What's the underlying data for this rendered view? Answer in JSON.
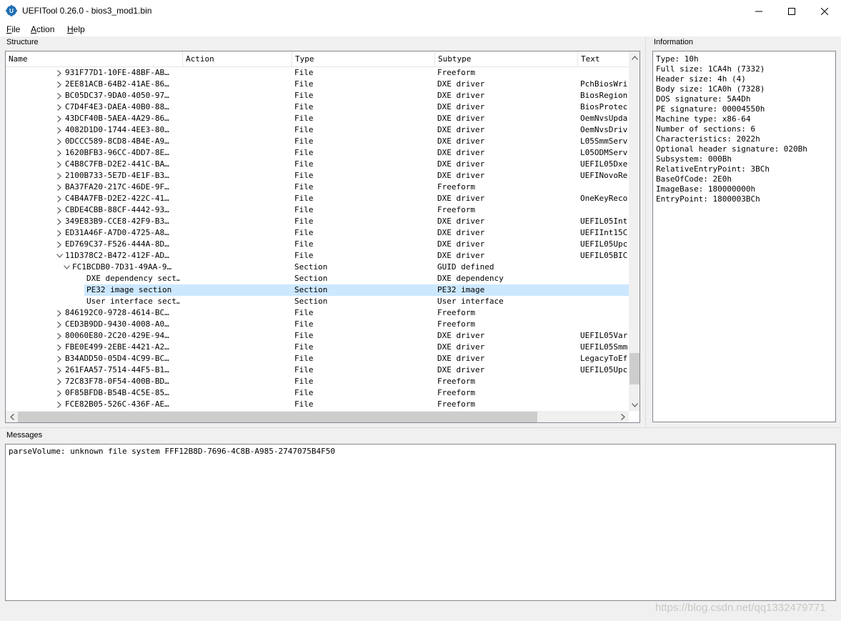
{
  "window": {
    "title": "UEFITool 0.26.0 - bios3_mod1.bin"
  },
  "menu": {
    "items": [
      {
        "acc": "F",
        "rest": "ile"
      },
      {
        "acc": "A",
        "rest": "ction"
      },
      {
        "acc": "H",
        "rest": "elp"
      }
    ]
  },
  "structure": {
    "label": "Structure",
    "columns": [
      "Name",
      "Action",
      "Type",
      "Subtype",
      "Text"
    ],
    "rows": [
      {
        "name": "931F77D1-10FE-48BF-AB…",
        "type": "File",
        "subtype": "Freeform",
        "text": "",
        "depth": 0,
        "expander": "collapsed"
      },
      {
        "name": "2EE81ACB-64B2-41AE-86…",
        "type": "File",
        "subtype": "DXE driver",
        "text": "PchBiosWri",
        "depth": 0,
        "expander": "collapsed"
      },
      {
        "name": "BC05DC37-9DA0-4050-97…",
        "type": "File",
        "subtype": "DXE driver",
        "text": "BiosRegion",
        "depth": 0,
        "expander": "collapsed"
      },
      {
        "name": "C7D4F4E3-DAEA-40B0-88…",
        "type": "File",
        "subtype": "DXE driver",
        "text": "BiosProtec",
        "depth": 0,
        "expander": "collapsed"
      },
      {
        "name": "43DCF40B-5AEA-4A29-86…",
        "type": "File",
        "subtype": "DXE driver",
        "text": "OemNvsUpda",
        "depth": 0,
        "expander": "collapsed"
      },
      {
        "name": "4082D1D0-1744-4EE3-80…",
        "type": "File",
        "subtype": "DXE driver",
        "text": "OemNvsDriv",
        "depth": 0,
        "expander": "collapsed"
      },
      {
        "name": "0DCCC589-8CD8-4B4E-A9…",
        "type": "File",
        "subtype": "DXE driver",
        "text": "L05SmmServ",
        "depth": 0,
        "expander": "collapsed"
      },
      {
        "name": "1620BFB3-96CC-4DD7-8E…",
        "type": "File",
        "subtype": "DXE driver",
        "text": "L05ODMServ",
        "depth": 0,
        "expander": "collapsed"
      },
      {
        "name": "C4B8C7FB-D2E2-441C-BA…",
        "type": "File",
        "subtype": "DXE driver",
        "text": "UEFIL05Dxe",
        "depth": 0,
        "expander": "collapsed"
      },
      {
        "name": "2100B733-5E7D-4E1F-B3…",
        "type": "File",
        "subtype": "DXE driver",
        "text": "UEFINovoRe",
        "depth": 0,
        "expander": "collapsed"
      },
      {
        "name": "BA37FA20-217C-46DE-9F…",
        "type": "File",
        "subtype": "Freeform",
        "text": "",
        "depth": 0,
        "expander": "collapsed"
      },
      {
        "name": "C4B4A7FB-D2E2-422C-41…",
        "type": "File",
        "subtype": "DXE driver",
        "text": "OneKeyReco",
        "depth": 0,
        "expander": "collapsed"
      },
      {
        "name": "CBDE4CBB-88CF-4442-93…",
        "type": "File",
        "subtype": "Freeform",
        "text": "",
        "depth": 0,
        "expander": "collapsed"
      },
      {
        "name": "349E83B9-CCE8-42F9-B3…",
        "type": "File",
        "subtype": "DXE driver",
        "text": "UEFIL05Int",
        "depth": 0,
        "expander": "collapsed"
      },
      {
        "name": "ED31A46F-A7D0-4725-A8…",
        "type": "File",
        "subtype": "DXE driver",
        "text": "UEFIInt15C",
        "depth": 0,
        "expander": "collapsed"
      },
      {
        "name": "ED769C37-F526-444A-8D…",
        "type": "File",
        "subtype": "DXE driver",
        "text": "UEFIL05Upc",
        "depth": 0,
        "expander": "collapsed"
      },
      {
        "name": "11D378C2-B472-412F-AD…",
        "type": "File",
        "subtype": "DXE driver",
        "text": "UEFIL05BIC",
        "depth": 0,
        "expander": "expanded"
      },
      {
        "name": "FC1BCDB0-7D31-49AA-9…",
        "type": "Section",
        "subtype": "GUID defined",
        "text": "",
        "depth": 1,
        "expander": "expanded"
      },
      {
        "name": "DXE dependency sect…",
        "type": "Section",
        "subtype": "DXE dependency",
        "text": "",
        "depth": 2,
        "expander": "none"
      },
      {
        "name": "PE32 image section",
        "type": "Section",
        "subtype": "PE32 image",
        "text": "",
        "depth": 2,
        "expander": "none",
        "selected": true
      },
      {
        "name": "User interface sect…",
        "type": "Section",
        "subtype": "User interface",
        "text": "",
        "depth": 2,
        "expander": "none"
      },
      {
        "name": "846192C0-9728-4614-BC…",
        "type": "File",
        "subtype": "Freeform",
        "text": "",
        "depth": 0,
        "expander": "collapsed"
      },
      {
        "name": "CED3B9DD-9430-4008-A0…",
        "type": "File",
        "subtype": "Freeform",
        "text": "",
        "depth": 0,
        "expander": "collapsed"
      },
      {
        "name": "80060E80-2C20-429E-94…",
        "type": "File",
        "subtype": "DXE driver",
        "text": "UEFIL05Var",
        "depth": 0,
        "expander": "collapsed"
      },
      {
        "name": "FBE0E499-2EBE-4421-A2…",
        "type": "File",
        "subtype": "DXE driver",
        "text": "UEFIL05Smm",
        "depth": 0,
        "expander": "collapsed"
      },
      {
        "name": "B34ADD50-05D4-4C99-BC…",
        "type": "File",
        "subtype": "DXE driver",
        "text": "LegacyToEf",
        "depth": 0,
        "expander": "collapsed"
      },
      {
        "name": "261FAA57-7514-44F5-B1…",
        "type": "File",
        "subtype": "DXE driver",
        "text": "UEFIL05Upc",
        "depth": 0,
        "expander": "collapsed"
      },
      {
        "name": "72C83F78-0F54-400B-BD…",
        "type": "File",
        "subtype": "Freeform",
        "text": "",
        "depth": 0,
        "expander": "collapsed"
      },
      {
        "name": "0F85BFDB-B54B-4C5E-85…",
        "type": "File",
        "subtype": "Freeform",
        "text": "",
        "depth": 0,
        "expander": "collapsed"
      },
      {
        "name": "FCE82B05-526C-436F-AE…",
        "type": "File",
        "subtype": "Freeform",
        "text": "",
        "depth": 0,
        "expander": "collapsed"
      }
    ]
  },
  "information": {
    "label": "Information",
    "lines": [
      "Type: 10h",
      "Full size: 1CA4h (7332)",
      "Header size: 4h (4)",
      "Body size: 1CA0h (7328)",
      "DOS signature: 5A4Dh",
      "PE signature: 00004550h",
      "Machine type: x86-64",
      "Number of sections: 6",
      "Characteristics: 2022h",
      "Optional header signature: 020Bh",
      "Subsystem: 000Bh",
      "RelativeEntryPoint: 3BCh",
      "BaseOfCode: 2E0h",
      "ImageBase: 180000000h",
      "EntryPoint: 1800003BCh"
    ]
  },
  "messages": {
    "label": "Messages",
    "lines": [
      "parseVolume: unknown file system FFF12B8D-7696-4C8B-A985-2747075B4F50"
    ]
  },
  "watermark": "https://blog.csdn.net/qq1332479771",
  "colors": {
    "selection": "#cce8ff",
    "border": "#828790",
    "background": "#f0f0f0",
    "icon": "#1f6fb5"
  }
}
